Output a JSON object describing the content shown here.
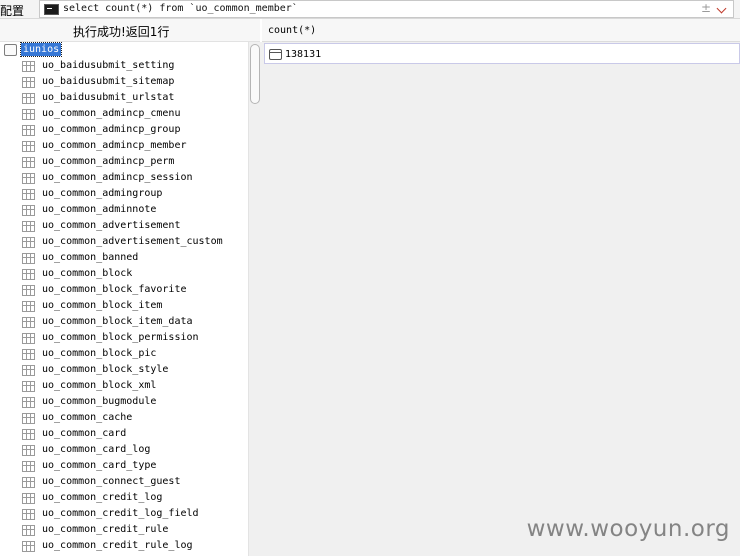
{
  "toolbar": {
    "config_label": "配置",
    "sql_text": "select count(*) from `uo_common_member`",
    "plus_minus": "±"
  },
  "status": {
    "message": "执行成功!返回1行"
  },
  "tree": {
    "database": "iunios",
    "tables": [
      "uo_baidusubmit_setting",
      "uo_baidusubmit_sitemap",
      "uo_baidusubmit_urlstat",
      "uo_common_admincp_cmenu",
      "uo_common_admincp_group",
      "uo_common_admincp_member",
      "uo_common_admincp_perm",
      "uo_common_admincp_session",
      "uo_common_admingroup",
      "uo_common_adminnote",
      "uo_common_advertisement",
      "uo_common_advertisement_custom",
      "uo_common_banned",
      "uo_common_block",
      "uo_common_block_favorite",
      "uo_common_block_item",
      "uo_common_block_item_data",
      "uo_common_block_permission",
      "uo_common_block_pic",
      "uo_common_block_style",
      "uo_common_block_xml",
      "uo_common_bugmodule",
      "uo_common_cache",
      "uo_common_card",
      "uo_common_card_log",
      "uo_common_card_type",
      "uo_common_connect_guest",
      "uo_common_credit_log",
      "uo_common_credit_log_field",
      "uo_common_credit_rule",
      "uo_common_credit_rule_log"
    ]
  },
  "result": {
    "columns": [
      "count(*)"
    ],
    "rows": [
      [
        "138131"
      ]
    ]
  },
  "watermark": "www.wooyun.org"
}
